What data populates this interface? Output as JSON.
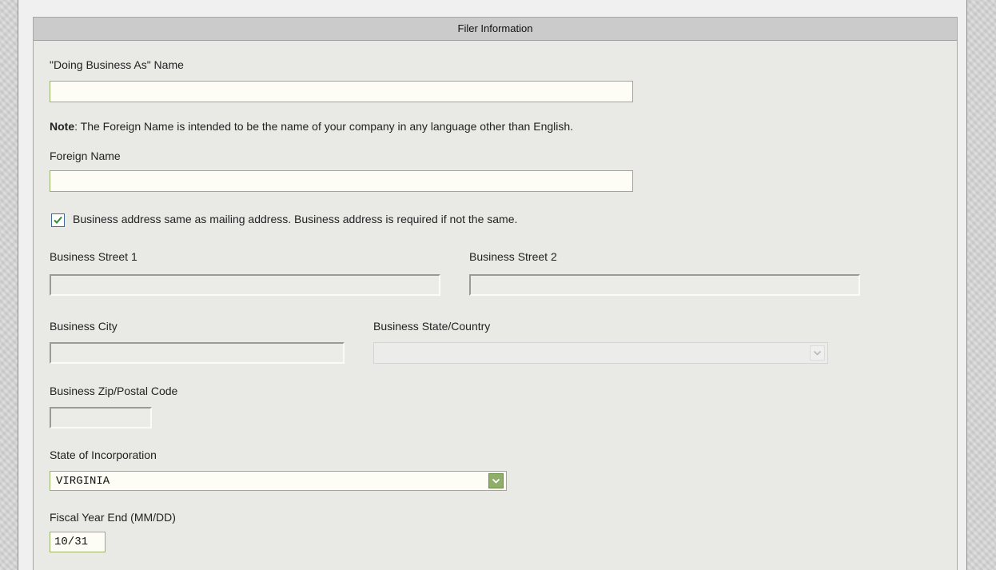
{
  "panel": {
    "title": "Filer Information"
  },
  "dba": {
    "label": "\"Doing Business As\" Name",
    "value": ""
  },
  "note": {
    "bold": "Note",
    "text": ": The Foreign Name is intended to be the name of your company in any language other than English."
  },
  "foreign_name": {
    "label": "Foreign Name",
    "value": ""
  },
  "same_address": {
    "checked": true,
    "label": "Business address same as mailing address. Business address is required if not the same."
  },
  "business_street_1": {
    "label": "Business Street 1",
    "value": ""
  },
  "business_street_2": {
    "label": "Business Street 2",
    "value": ""
  },
  "business_city": {
    "label": "Business City",
    "value": ""
  },
  "business_state": {
    "label": "Business State/Country",
    "value": ""
  },
  "business_zip": {
    "label": "Business Zip/Postal Code",
    "value": ""
  },
  "state_of_incorporation": {
    "label": "State of Incorporation",
    "value": "VIRGINIA"
  },
  "fiscal_year_end": {
    "label": "Fiscal Year End (MM/DD)",
    "value": "10/31"
  },
  "colors": {
    "active_border": "#9ab36a",
    "checkbox_check": "#2e8b2e",
    "select_arrow_bg": "#8fae6a"
  }
}
